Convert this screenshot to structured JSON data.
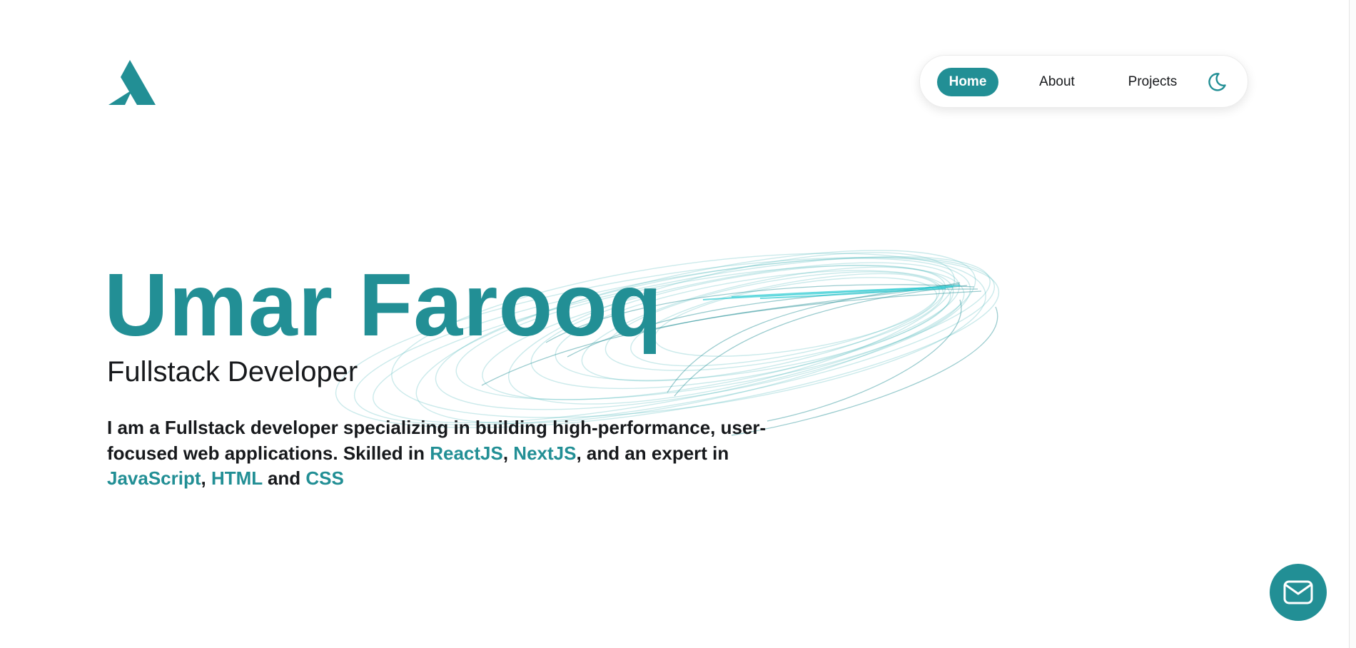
{
  "brand": {
    "logo_icon": "letter-a-logo-icon",
    "accent_color": "#228f95"
  },
  "nav": {
    "items": [
      {
        "label": "Home",
        "active": true
      },
      {
        "label": "About",
        "active": false
      },
      {
        "label": "Projects",
        "active": false
      }
    ],
    "theme_toggle_icon": "moon-icon"
  },
  "hero": {
    "name": "Umar Farooq",
    "role": "Fullstack Developer",
    "description": {
      "part1": "I am a Fullstack developer specializing in building high-performance, user-focused web applications. Skilled in ",
      "skill1": "ReactJS",
      "sep1": ", ",
      "skill2": "NextJS",
      "part2": ", and an expert in ",
      "skill3": "JavaScript",
      "sep2": ", ",
      "skill4": "HTML",
      "part3": " and ",
      "skill5": "CSS"
    }
  },
  "contact_fab": {
    "icon": "mail-icon"
  }
}
